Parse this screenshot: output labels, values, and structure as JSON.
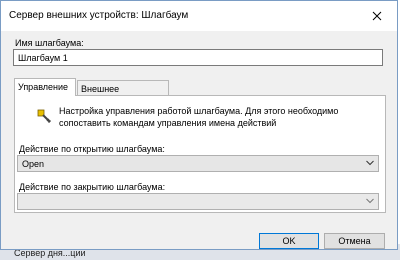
{
  "window": {
    "title": "Сервер внешних устройств: Шлагбаум"
  },
  "name_field": {
    "label": "Имя шлагбаума:",
    "value": "Шлагбаум 1"
  },
  "tabs": [
    {
      "label": "Управление",
      "active": true
    },
    {
      "label": "Внешнее управление",
      "active": false
    }
  ],
  "panel": {
    "description": "Настройка управления работой шлагбаума. Для этого необходимо сопоставить командам управления имена действий",
    "open_action": {
      "label": "Действие по открытию шлагбаума:",
      "value": "Open"
    },
    "close_action": {
      "label": "Действие по закрытию шлагбаума:",
      "value": ""
    }
  },
  "buttons": {
    "ok": "OK",
    "cancel": "Отмена"
  },
  "background": {
    "text": "Сервер дня...ции"
  },
  "icons": {
    "close": "close-icon",
    "key": "key-icon",
    "dropdown": "chevron-down-icon"
  },
  "colors": {
    "accent_border": "#0078d7",
    "window_border": "#7a9cc4"
  }
}
